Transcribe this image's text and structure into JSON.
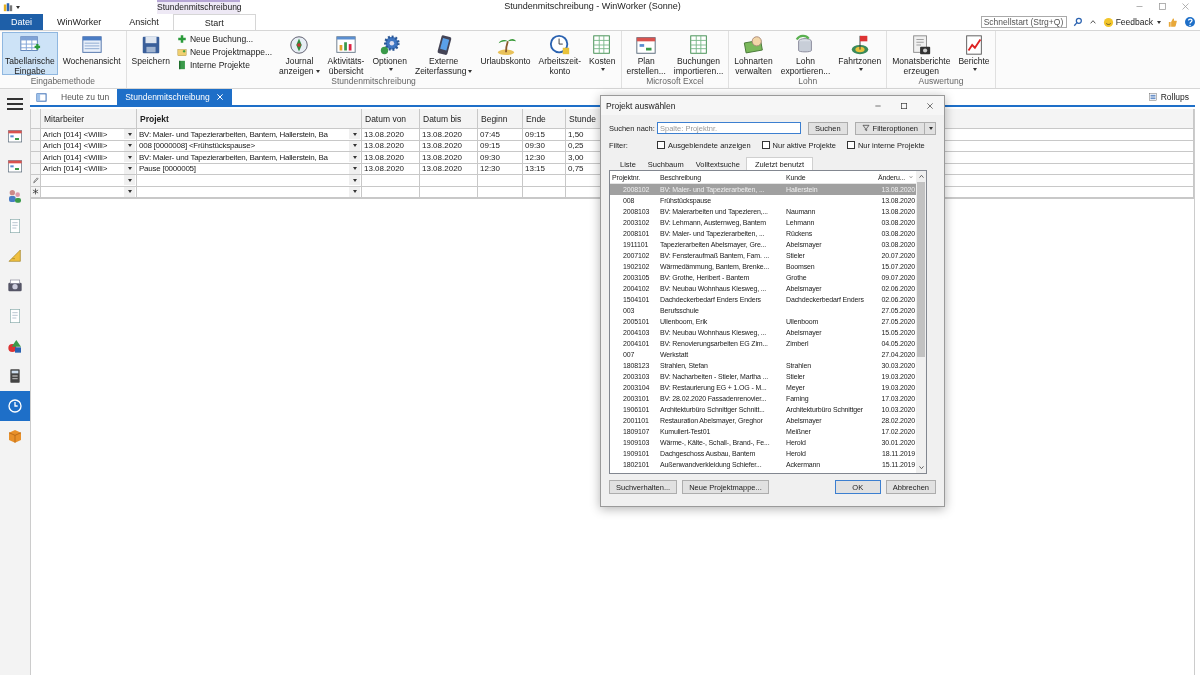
{
  "title_bar": {
    "title": "Stundenmitschreibung - WinWorker (Sonne)",
    "context_tab": "Stundenmitschreibung"
  },
  "ribbon_tabs": [
    {
      "label": "Datei",
      "kind": "file",
      "selected": false
    },
    {
      "label": "WinWorker",
      "kind": "tab",
      "selected": false
    },
    {
      "label": "Ansicht",
      "kind": "tab",
      "selected": false
    },
    {
      "label": "Start",
      "kind": "tab",
      "selected": true
    }
  ],
  "quick_search": {
    "placeholder": "Schnellstart (Strg+Q)"
  },
  "feedback": {
    "label": "Feedback"
  },
  "ribbon_groups": [
    {
      "label": "Eingabemethode",
      "buttons": [
        {
          "kind": "large",
          "lines": [
            "Tabellarische",
            "Eingabe"
          ],
          "dropdown": false,
          "selected": true
        },
        {
          "kind": "large",
          "lines": [
            "Wochenansicht"
          ],
          "dropdown": false,
          "selected": false
        }
      ]
    },
    {
      "label": "Stundenmitschreibung",
      "buttons": [
        {
          "kind": "large",
          "lines": [
            "Speichern"
          ],
          "dropdown": false,
          "selected": false
        },
        {
          "kind": "stack",
          "items": [
            {
              "label": "Neue Buchung..."
            },
            {
              "label": "Neue Projektmappe..."
            },
            {
              "label": "Interne Projekte"
            }
          ]
        },
        {
          "kind": "large",
          "lines": [
            "Journal",
            "anzeigen"
          ],
          "dropdown": true,
          "selected": false
        },
        {
          "kind": "large",
          "lines": [
            "Aktivitäts-",
            "übersicht"
          ],
          "dropdown": false,
          "selected": false
        },
        {
          "kind": "large",
          "lines": [
            "Optionen"
          ],
          "dropdown": true,
          "selected": false
        },
        {
          "kind": "large",
          "lines": [
            "Externe",
            "Zeiterfassung"
          ],
          "dropdown": true,
          "selected": false
        },
        {
          "kind": "large",
          "lines": [
            "Urlaubskonto"
          ],
          "dropdown": false,
          "selected": false
        },
        {
          "kind": "large",
          "lines": [
            "Arbeitszeit-",
            "konto"
          ],
          "dropdown": false,
          "selected": false
        },
        {
          "kind": "large",
          "lines": [
            "Kosten"
          ],
          "dropdown": true,
          "selected": false
        }
      ]
    },
    {
      "label": "Microsoft Excel",
      "buttons": [
        {
          "kind": "large",
          "lines": [
            "Plan",
            "erstellen..."
          ],
          "dropdown": false,
          "selected": false
        },
        {
          "kind": "large",
          "lines": [
            "Buchungen",
            "importieren..."
          ],
          "dropdown": false,
          "selected": false
        }
      ]
    },
    {
      "label": "Lohn",
      "buttons": [
        {
          "kind": "large",
          "lines": [
            "Lohnarten",
            "verwalten"
          ],
          "dropdown": false,
          "selected": false
        },
        {
          "kind": "large",
          "lines": [
            "Lohn",
            "exportieren..."
          ],
          "dropdown": false,
          "selected": false
        },
        {
          "kind": "large",
          "lines": [
            "Fahrtzonen"
          ],
          "dropdown": true,
          "selected": false
        }
      ]
    },
    {
      "label": "Auswertung",
      "buttons": [
        {
          "kind": "large",
          "lines": [
            "Monatsberichte",
            "erzeugen"
          ],
          "dropdown": false,
          "selected": false
        },
        {
          "kind": "large",
          "lines": [
            "Berichte"
          ],
          "dropdown": true,
          "selected": false
        }
      ]
    }
  ],
  "sidebar": {
    "items": [
      {
        "selected": false
      },
      {
        "selected": false
      },
      {
        "selected": false
      },
      {
        "selected": false
      },
      {
        "selected": false
      },
      {
        "selected": false
      },
      {
        "selected": false
      },
      {
        "selected": false
      },
      {
        "selected": false
      },
      {
        "selected": true
      },
      {
        "selected": false
      }
    ]
  },
  "doc_tabs": [
    {
      "label": "Heute zu tun",
      "selected": false,
      "closable": false
    },
    {
      "label": "Stundenmitschreibung",
      "selected": true,
      "closable": true
    }
  ],
  "rollups": {
    "label": "Rollups"
  },
  "grid": {
    "columns": [
      {
        "label": "Mitarbeiter",
        "bold": false,
        "combo": true
      },
      {
        "label": "Projekt",
        "bold": true,
        "combo": true
      },
      {
        "label": "Datum von",
        "bold": false,
        "combo": false
      },
      {
        "label": "Datum bis",
        "bold": false,
        "combo": false
      },
      {
        "label": "Beginn",
        "bold": false,
        "combo": false
      },
      {
        "label": "Ende",
        "bold": false,
        "combo": false
      },
      {
        "label": "Stunde",
        "bold": false,
        "combo": false
      }
    ],
    "rows": [
      {
        "kind": "data",
        "cells": [
          "Arich [014]  <Willi>",
          "BV: Maler- und Tapezierarbeiten, Bantem, Hallerstein, Ba",
          "13.08.2020",
          "13.08.2020",
          "07:45",
          "09:15",
          "1,50"
        ]
      },
      {
        "kind": "data",
        "cells": [
          "Arich [014]  <Willi>",
          "008 [0000008]  <Frühstückspause>",
          "13.08.2020",
          "13.08.2020",
          "09:15",
          "09:30",
          "0,25"
        ]
      },
      {
        "kind": "data",
        "cells": [
          "Arich [014]  <Willi>",
          "BV: Maler- und Tapezierarbeiten, Bantem, Hallerstein, Ba",
          "13.08.2020",
          "13.08.2020",
          "09:30",
          "12:30",
          "3,00"
        ]
      },
      {
        "kind": "data",
        "cells": [
          "Arich [014]  <Willi>",
          "Pause [0000005]",
          "13.08.2020",
          "13.08.2020",
          "12:30",
          "13:15",
          "0,75"
        ]
      },
      {
        "kind": "edit"
      },
      {
        "kind": "new"
      }
    ]
  },
  "dialog": {
    "title": "Projekt auswählen",
    "search_label": "Suchen nach:",
    "search_field": {
      "placeholder": "Spalte: Projektnr."
    },
    "search_button": "Suchen",
    "filter_options_button": "Filteroptionen",
    "filter_label": "Filter:",
    "filters": [
      {
        "label": "Ausgeblendete anzeigen",
        "checked": false
      },
      {
        "label": "Nur aktive Projekte",
        "checked": false
      },
      {
        "label": "Nur interne Projekte",
        "checked": false
      }
    ],
    "tabs": [
      {
        "label": "Liste",
        "selected": false
      },
      {
        "label": "Suchbaum",
        "selected": false
      },
      {
        "label": "Volltextsuche",
        "selected": false
      },
      {
        "label": "Zuletzt benutzt",
        "selected": true
      }
    ],
    "list": {
      "columns": [
        "Projektnr.",
        "Beschreibung",
        "Kunde",
        "Änderu..."
      ],
      "rows": [
        {
          "cells": [
            "2008102",
            "BV: Maler- und Tapezierarbeiten, ...",
            "Hallerstein",
            "13.08.2020"
          ],
          "selected": true
        },
        {
          "cells": [
            "008",
            "Frühstückspause",
            "",
            "13.08.2020"
          ],
          "selected": false
        },
        {
          "cells": [
            "2008103",
            "BV: Malerarbeiten und Tapezieren,...",
            "Naumann",
            "13.08.2020"
          ],
          "selected": false
        },
        {
          "cells": [
            "2003102",
            "BV: Lehmann, Austernweg, Bantem",
            "Lehmann",
            "03.08.2020"
          ],
          "selected": false
        },
        {
          "cells": [
            "2008101",
            "BV: Maler- und Tapezierarbeiten, ...",
            "Rückens",
            "03.08.2020"
          ],
          "selected": false
        },
        {
          "cells": [
            "1911101",
            "Tapezierarbeiten Abelsmayer, Gre...",
            "Abelsmayer",
            "03.08.2020"
          ],
          "selected": false
        },
        {
          "cells": [
            "2007102",
            "BV: Fensteraufmaß Bantem, Fam. ...",
            "Stieler",
            "20.07.2020"
          ],
          "selected": false
        },
        {
          "cells": [
            "1902102",
            "Wärmedämmung, Bantem, Brenke...",
            "Boomsen",
            "15.07.2020"
          ],
          "selected": false
        },
        {
          "cells": [
            "2003105",
            "BV: Grothe, Heribert - Bantem",
            "Grothe",
            "09.07.2020"
          ],
          "selected": false
        },
        {
          "cells": [
            "2004102",
            "BV: Neubau Wohnhaus Kiesweg, ...",
            "Abelsmayer",
            "02.06.2020"
          ],
          "selected": false
        },
        {
          "cells": [
            "1504101",
            "Dachdeckerbedarf Enders Enders",
            "Dachdeckerbedarf Enders",
            "02.06.2020"
          ],
          "selected": false
        },
        {
          "cells": [
            "003",
            "Berufsschule",
            "",
            "27.05.2020"
          ],
          "selected": false
        },
        {
          "cells": [
            "2005101",
            "Ullenboom, Erik",
            "Ullenboom",
            "27.05.2020"
          ],
          "selected": false
        },
        {
          "cells": [
            "2004103",
            "BV: Neubau Wohnhaus Kiesweg, ...",
            "Abelsmayer",
            "15.05.2020"
          ],
          "selected": false
        },
        {
          "cells": [
            "2004101",
            "BV: Renovierungsarbeiten EG Zim...",
            "Zimberl",
            "04.05.2020"
          ],
          "selected": false
        },
        {
          "cells": [
            "007",
            "Werkstatt",
            "",
            "27.04.2020"
          ],
          "selected": false
        },
        {
          "cells": [
            "1808123",
            "Strahlen, Stefan",
            "Strahlen",
            "30.03.2020"
          ],
          "selected": false
        },
        {
          "cells": [
            "2003103",
            "BV: Nacharbeiten - Stieler, Martha ...",
            "Stieler",
            "19.03.2020"
          ],
          "selected": false
        },
        {
          "cells": [
            "2003104",
            "BV: Restaurierung EG + 1.OG - M...",
            "Meyer",
            "19.03.2020"
          ],
          "selected": false
        },
        {
          "cells": [
            "2003101",
            "BV: 28.02.2020 Fassadenrenovier...",
            "Faming",
            "17.03.2020"
          ],
          "selected": false
        },
        {
          "cells": [
            "1906101",
            "Architekturbüro  Schnittger Schnitt...",
            "Architekturbüro  Schnittger",
            "10.03.2020"
          ],
          "selected": false
        },
        {
          "cells": [
            "2001101",
            "Restauration Abelsmayer, Greghor",
            "Abelsmayer",
            "28.02.2020"
          ],
          "selected": false
        },
        {
          "cells": [
            "1809107",
            "Kumuliert-Test01",
            "Meißner",
            "17.02.2020"
          ],
          "selected": false
        },
        {
          "cells": [
            "1909103",
            "Wärme-, Kälte-, Schall-, Brand-, Fe...",
            "Herold",
            "30.01.2020"
          ],
          "selected": false
        },
        {
          "cells": [
            "1909101",
            "Dachgeschoss Ausbau, Bantem",
            "Herold",
            "18.11.2019"
          ],
          "selected": false
        },
        {
          "cells": [
            "1802101",
            "Außenwandverkleidung Schiefer...",
            "Ackermann",
            "15.11.2019"
          ],
          "selected": false
        }
      ]
    },
    "buttons": [
      {
        "label": "Suchverhalten...",
        "kind": "left",
        "default": false
      },
      {
        "label": "Neue Projektmappe...",
        "kind": "left",
        "default": false
      },
      {
        "label": "OK",
        "kind": "right",
        "default": true
      },
      {
        "label": "Abbrechen",
        "kind": "right",
        "default": false
      }
    ]
  }
}
